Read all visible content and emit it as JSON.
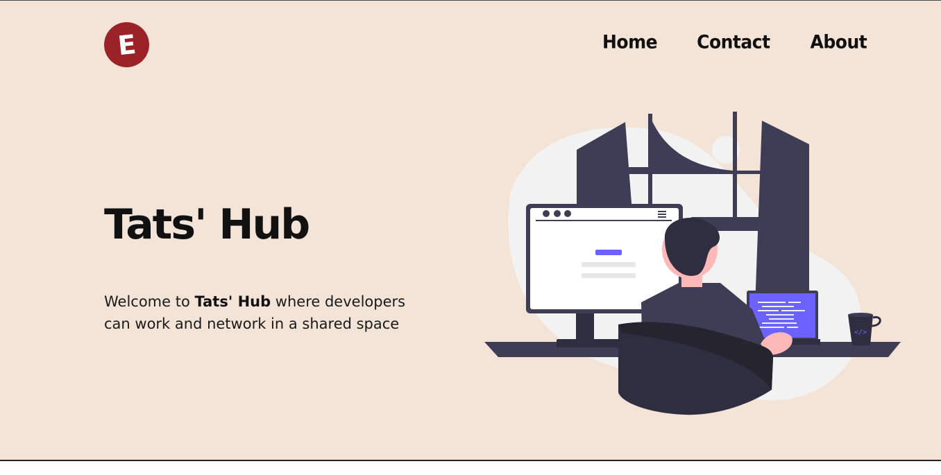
{
  "brand": {
    "logo_letter": "E",
    "logo_color": "#9b2226"
  },
  "nav": {
    "items": [
      "Home",
      "Contact",
      "About"
    ]
  },
  "hero": {
    "title": "Tats' Hub",
    "text_before": "Welcome to ",
    "text_bold": "Tats' Hub",
    "text_after": " where developers can work and network in a shared space"
  },
  "colors": {
    "background": "#f3e4d7",
    "dark": "#3f3d56",
    "accent": "#6c63ff"
  }
}
